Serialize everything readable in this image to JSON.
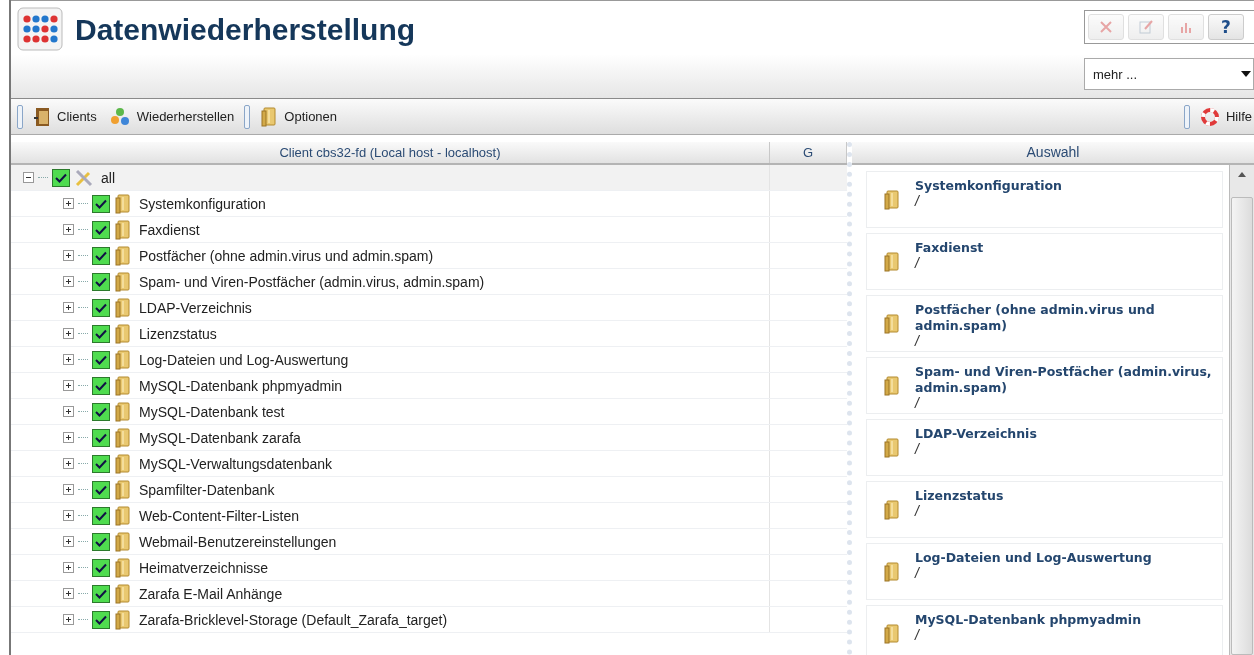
{
  "window": {
    "title": "Datenwiederherstellung"
  },
  "header_buttons": [
    {
      "kind": "close",
      "disabled": true
    },
    {
      "kind": "edit",
      "disabled": true
    },
    {
      "kind": "chart",
      "disabled": true
    },
    {
      "kind": "help",
      "label": "?",
      "disabled": false
    }
  ],
  "more_select": {
    "value": "mehr ..."
  },
  "toolbar": {
    "left": [
      {
        "kind": "grip"
      },
      {
        "kind": "clients",
        "label": "Clients"
      },
      {
        "kind": "restore",
        "label": "Wiederherstellen"
      },
      {
        "kind": "grip"
      },
      {
        "kind": "options",
        "label": "Optionen"
      }
    ],
    "right": [
      {
        "kind": "grip"
      },
      {
        "kind": "help",
        "label": "Hilfe"
      }
    ]
  },
  "tree_panel": {
    "columns": [
      "Client cbs32-fd (Local host - localhost)",
      "G"
    ],
    "root": {
      "label": "all",
      "expanded": true,
      "checked": true,
      "children": [
        {
          "label": "Systemkonfiguration",
          "expanded": false,
          "checked": true
        },
        {
          "label": "Faxdienst",
          "expanded": false,
          "checked": true
        },
        {
          "label": "Postfächer (ohne admin.virus und admin.spam)",
          "expanded": false,
          "checked": true
        },
        {
          "label": "Spam- und Viren-Postfächer (admin.virus, admin.spam)",
          "expanded": false,
          "checked": true
        },
        {
          "label": "LDAP-Verzeichnis",
          "expanded": false,
          "checked": true
        },
        {
          "label": "Lizenzstatus",
          "expanded": false,
          "checked": true
        },
        {
          "label": "Log-Dateien und Log-Auswertung",
          "expanded": false,
          "checked": true
        },
        {
          "label": "MySQL-Datenbank phpmyadmin",
          "expanded": false,
          "checked": true
        },
        {
          "label": "MySQL-Datenbank test",
          "expanded": false,
          "checked": true
        },
        {
          "label": "MySQL-Datenbank zarafa",
          "expanded": false,
          "checked": true
        },
        {
          "label": "MySQL-Verwaltungsdatenbank",
          "expanded": false,
          "checked": true
        },
        {
          "label": "Spamfilter-Datenbank",
          "expanded": false,
          "checked": true
        },
        {
          "label": "Web-Content-Filter-Listen",
          "expanded": false,
          "checked": true
        },
        {
          "label": "Webmail-Benutzereinstellungen",
          "expanded": false,
          "checked": true
        },
        {
          "label": "Heimatverzeichnisse",
          "expanded": false,
          "checked": true
        },
        {
          "label": "Zarafa E-Mail Anhänge",
          "expanded": false,
          "checked": true
        },
        {
          "label": "Zarafa-Bricklevel-Storage (Default_Zarafa_target)",
          "expanded": false,
          "checked": true
        }
      ]
    }
  },
  "selection_panel": {
    "title": "Auswahl",
    "items": [
      {
        "title": "Systemkonfiguration",
        "path": "/"
      },
      {
        "title": "Faxdienst",
        "path": "/"
      },
      {
        "title": "Postfächer (ohne admin.virus und admin.spam)",
        "path": "/"
      },
      {
        "title": "Spam- und Viren-Postfächer (admin.virus, admin.spam)",
        "path": "/"
      },
      {
        "title": "LDAP-Verzeichnis",
        "path": "/"
      },
      {
        "title": "Lizenzstatus",
        "path": "/"
      },
      {
        "title": "Log-Dateien und Log-Auswertung",
        "path": "/"
      },
      {
        "title": "MySQL-Datenbank phpmyadmin",
        "path": "/"
      }
    ]
  }
}
